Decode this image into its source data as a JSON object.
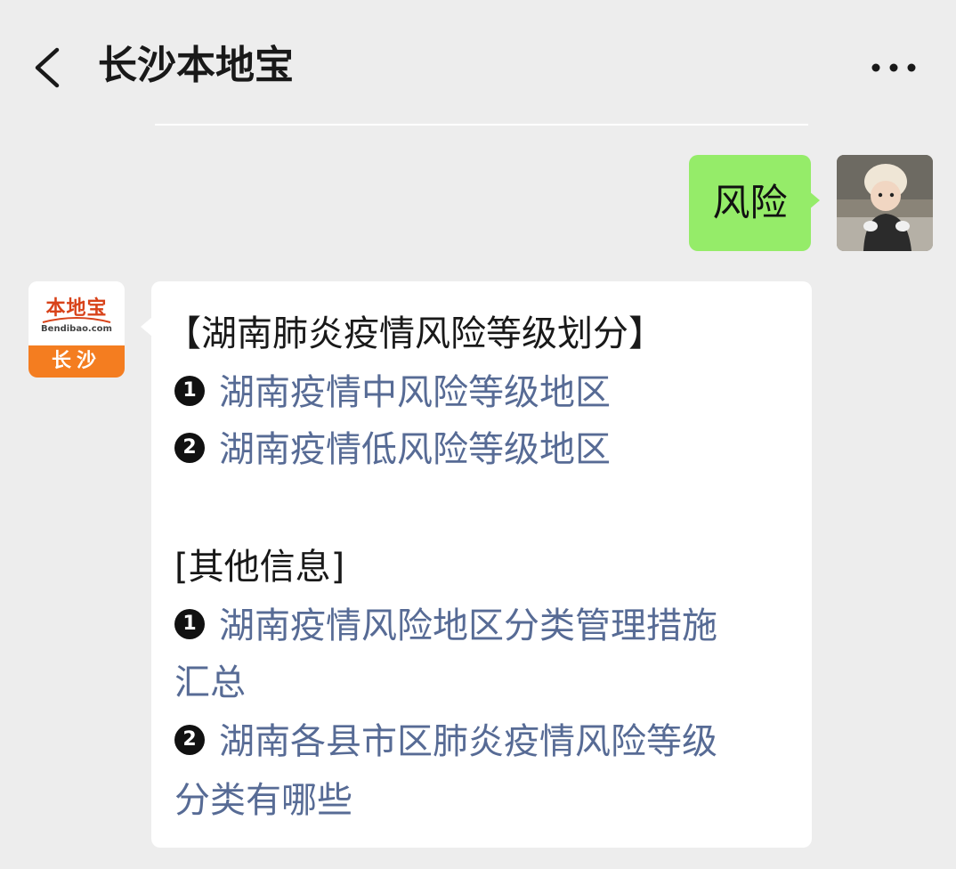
{
  "header": {
    "title": "长沙本地宝"
  },
  "outgoing_message": {
    "text": "风险"
  },
  "bot_avatar": {
    "brand": "本地宝",
    "url": "Bendibao.com",
    "city": "长沙"
  },
  "reply": {
    "heading": "【湖南肺炎疫情风险等级划分】",
    "items": [
      {
        "number": "1",
        "text": "湖南疫情中风险等级地区"
      },
      {
        "number": "2",
        "text": "湖南疫情低风险等级地区"
      }
    ],
    "other_heading": "[其他信息]",
    "other_items": [
      {
        "number": "1",
        "line1": "湖南疫情风险地区分类管理措施",
        "line2": "汇总"
      },
      {
        "number": "2",
        "line1": "湖南各县市区肺炎疫情风险等级",
        "line2": "分类有哪些"
      }
    ]
  },
  "colors": {
    "background": "#ededed",
    "outgoing_bubble": "#95ec69",
    "link": "#576b95",
    "brand_orange": "#f47d20"
  },
  "icons": {
    "back": "chevron-left-icon",
    "more": "more-dots-icon"
  }
}
